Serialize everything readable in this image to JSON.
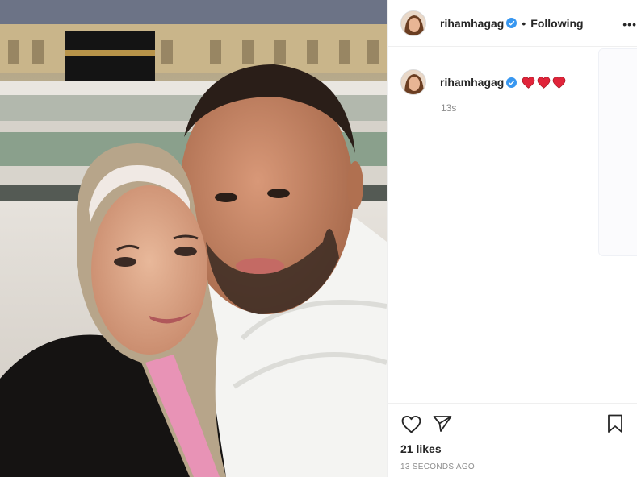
{
  "post": {
    "username": "rihamhagag",
    "verified_icon": "verified-badge-icon",
    "separator": "•",
    "follow_status": "Following",
    "more_icon": "more-options-icon"
  },
  "caption": {
    "username": "rihamhagag",
    "emoji": [
      "red-heart",
      "red-heart",
      "red-heart"
    ],
    "relative_time": "13s"
  },
  "actions": {
    "like_icon": "heart-outline-icon",
    "share_icon": "paper-plane-icon",
    "save_icon": "bookmark-icon",
    "likes": "21 likes",
    "timestamp": "13 SECONDS AGO"
  },
  "colors": {
    "verified": "#3897f0",
    "heart": "#e0243a",
    "secondary_text": "#8e8e8e",
    "border": "#efefef"
  }
}
